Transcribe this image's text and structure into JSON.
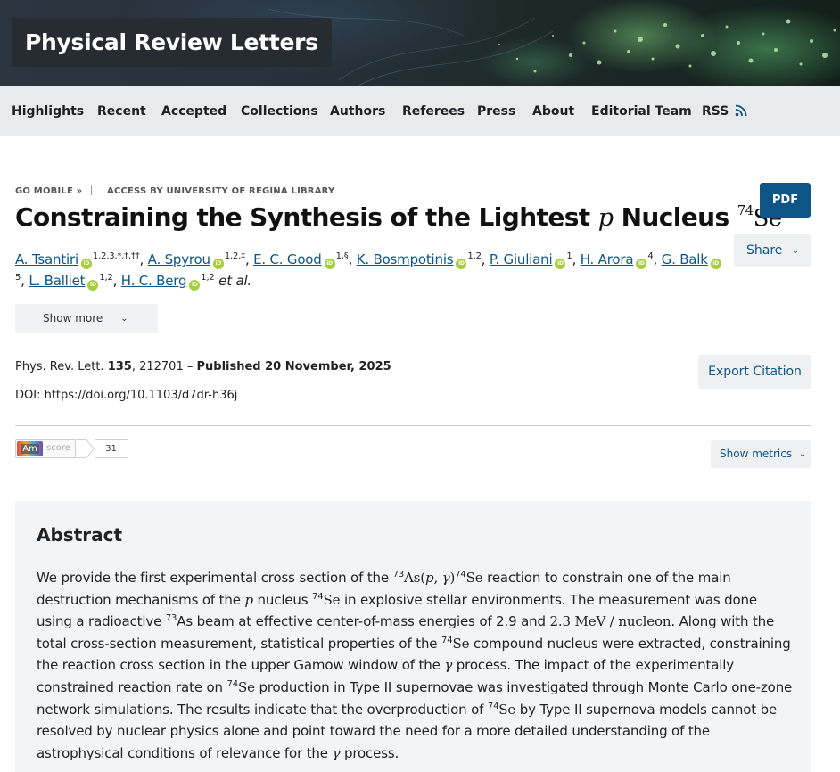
{
  "journal": {
    "title": "Physical Review Letters"
  },
  "nav": {
    "items": [
      "Highlights",
      "Recent",
      "Accepted",
      "Collections",
      "Authors",
      "Referees",
      "Press",
      "About",
      "Editorial Team",
      "RSS"
    ]
  },
  "breadcrumb": {
    "go_mobile": "GO MOBILE »",
    "access": "ACCESS BY UNIVERSITY OF REGINA LIBRARY"
  },
  "article": {
    "title_prefix": "Constraining the Synthesis of the Lightest",
    "title_math_p": "p",
    "title_word": "Nucleus",
    "title_mass": "74",
    "title_element": "Se"
  },
  "buttons": {
    "pdf": "PDF",
    "share": "Share",
    "show_more": "Show more",
    "export_citation": "Export Citation",
    "show_metrics": "Show metrics"
  },
  "authors": [
    {
      "name": "A. Tsantiri",
      "aff": "1,2,3,*,†,††"
    },
    {
      "name": "A. Spyrou",
      "aff": "1,2,‡"
    },
    {
      "name": "E. C. Good",
      "aff": "1,§"
    },
    {
      "name": "K. Bosmpotinis",
      "aff": "1,2"
    },
    {
      "name": "P. Giuliani",
      "aff": "1"
    },
    {
      "name": "H. Arora",
      "aff": "4"
    },
    {
      "name": "G. Balk",
      "aff": "5"
    },
    {
      "name": "L. Balliet",
      "aff": "1,2"
    },
    {
      "name": "H. C. Berg",
      "aff": "1,2"
    }
  ],
  "authors_etal": "et al.",
  "orcid_icon_text": "iD",
  "citation": {
    "journal_abbrev": "Phys. Rev. Lett.",
    "volume": "135",
    "article_number": ", 212701 – ",
    "published": "Published 20 November, 2025",
    "doi": "DOI: https://doi.org/10.1103/d7dr-h36j"
  },
  "altmetric": {
    "logo": "Am",
    "label": "score",
    "value": "31"
  },
  "abstract": {
    "heading": "Abstract",
    "parts": {
      "p1": "We provide the first experimental cross section of the ",
      "m73": "73",
      "as_open": "As(",
      "p_sym": "p",
      "comma": ", ",
      "gamma": "γ",
      "close": ")",
      "m74": "74",
      "se": "Se",
      "p2": " reaction to constrain one of the main destruction mechanisms of the ",
      "p3": " nucleus ",
      "p4": " in explosive stellar environments. The measurement was done using a radioactive ",
      "as": "As",
      "p5": " beam at effective center-of-mass energies of 2.9 and ",
      "energy": "2.3  MeV / nucleon",
      "p6": ". Along with the total cross-section measurement, statistical properties of the ",
      "p7": " compound nucleus were extracted, constraining the reaction cross section in the upper Gamow window of the ",
      "p8": " process. The impact of the experimentally constrained reaction rate on ",
      "p9": " production in Type II supernovae was investigated through Monte Carlo one-zone network simulations. The results indicate that the overproduction of ",
      "p10": " by Type II supernova models cannot be resolved by nuclear physics alone and point toward the need for a more detailed understanding of the astrophysical conditions of relevance for the ",
      "p11": " process."
    }
  },
  "colors": {
    "accent": "#0d5487",
    "orcid": "#a6ce39",
    "nav_bg": "#e9eaec",
    "abstract_bg": "#f3f4f6"
  }
}
